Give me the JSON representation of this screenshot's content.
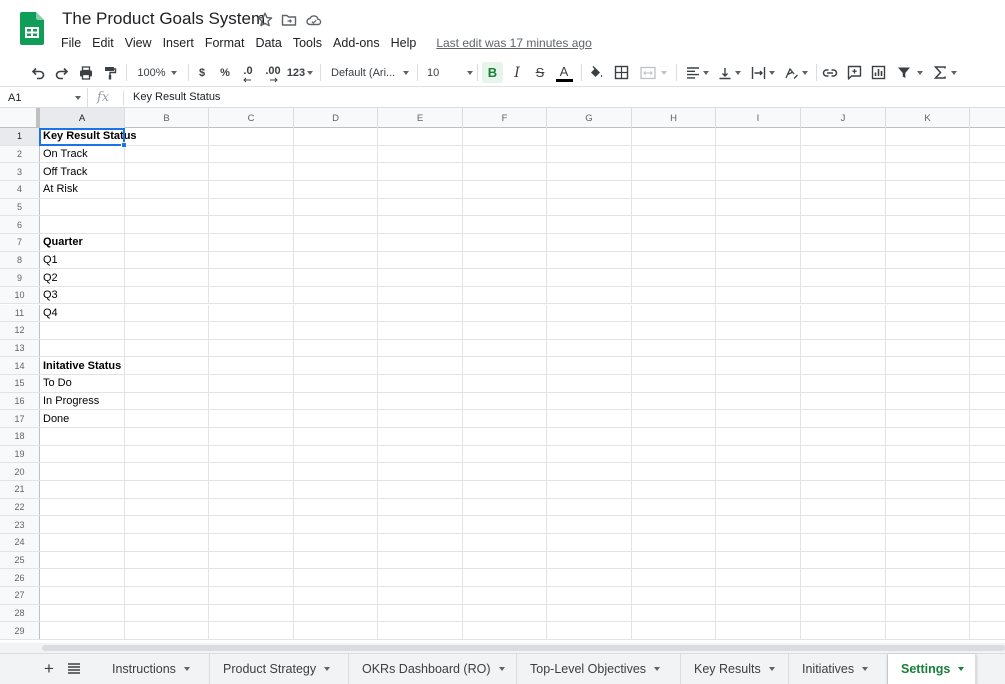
{
  "document": {
    "title": "The Product Goals System",
    "last_edit": "Last edit was 17 minutes ago"
  },
  "menu": [
    "File",
    "Edit",
    "View",
    "Insert",
    "Format",
    "Data",
    "Tools",
    "Add-ons",
    "Help"
  ],
  "toolbar": {
    "zoom": "100%",
    "currency": "$",
    "percent": "%",
    "decrease_decimal": ".0",
    "increase_decimal": ".00",
    "more_formats": "123",
    "font": "Default (Ari...",
    "font_size": "10",
    "bold": "B",
    "italic": "I",
    "strike": "S",
    "text_color": "A",
    "icons": [
      "undo-icon",
      "redo-icon",
      "print-icon",
      "paint-format-icon",
      "fill-color-icon",
      "borders-icon",
      "merge-cells-icon",
      "align-horizontal-icon",
      "align-vertical-icon",
      "text-wrap-icon",
      "text-rotate-icon",
      "link-icon",
      "comment-icon",
      "chart-icon",
      "filter-icon",
      "functions-icon"
    ]
  },
  "formula_bar": {
    "name_box": "A1",
    "fx": "fx",
    "value": "Key Result Status"
  },
  "grid": {
    "columns": [
      "A",
      "B",
      "C",
      "D",
      "E",
      "F",
      "G",
      "H",
      "I",
      "J",
      "K"
    ],
    "row_numbers": [
      "1",
      "2",
      "3",
      "4",
      "5",
      "6",
      "7",
      "8",
      "9",
      "10",
      "11",
      "12",
      "13",
      "14",
      "15",
      "16",
      "17",
      "18",
      "19",
      "20",
      "21",
      "22",
      "23",
      "24",
      "25",
      "26",
      "27",
      "28",
      "29"
    ],
    "column_a": [
      {
        "text": "Key Result Status",
        "bold": true
      },
      {
        "text": "On Track",
        "bold": false
      },
      {
        "text": "Off Track",
        "bold": false
      },
      {
        "text": "At Risk",
        "bold": false
      },
      {
        "text": "",
        "bold": false
      },
      {
        "text": "",
        "bold": false
      },
      {
        "text": "Quarter",
        "bold": true
      },
      {
        "text": "Q1",
        "bold": false
      },
      {
        "text": "Q2",
        "bold": false
      },
      {
        "text": "Q3",
        "bold": false
      },
      {
        "text": "Q4",
        "bold": false
      },
      {
        "text": "",
        "bold": false
      },
      {
        "text": "",
        "bold": false
      },
      {
        "text": "Initative Status",
        "bold": true
      },
      {
        "text": "To Do",
        "bold": false
      },
      {
        "text": "In Progress",
        "bold": false
      },
      {
        "text": "Done",
        "bold": false
      }
    ],
    "selected_cell": "A1"
  },
  "sheet_tabs": [
    "Instructions",
    "Product Strategy",
    "OKRs Dashboard (RO)",
    "Top-Level Objectives",
    "Key Results",
    "Initiatives",
    "Settings"
  ],
  "active_tab": "Settings",
  "colors": {
    "sheets_green": "#188038",
    "selection_blue": "#1a73e8",
    "header_bg": "#f8f9fa",
    "grid_line": "#e2e3e3"
  }
}
